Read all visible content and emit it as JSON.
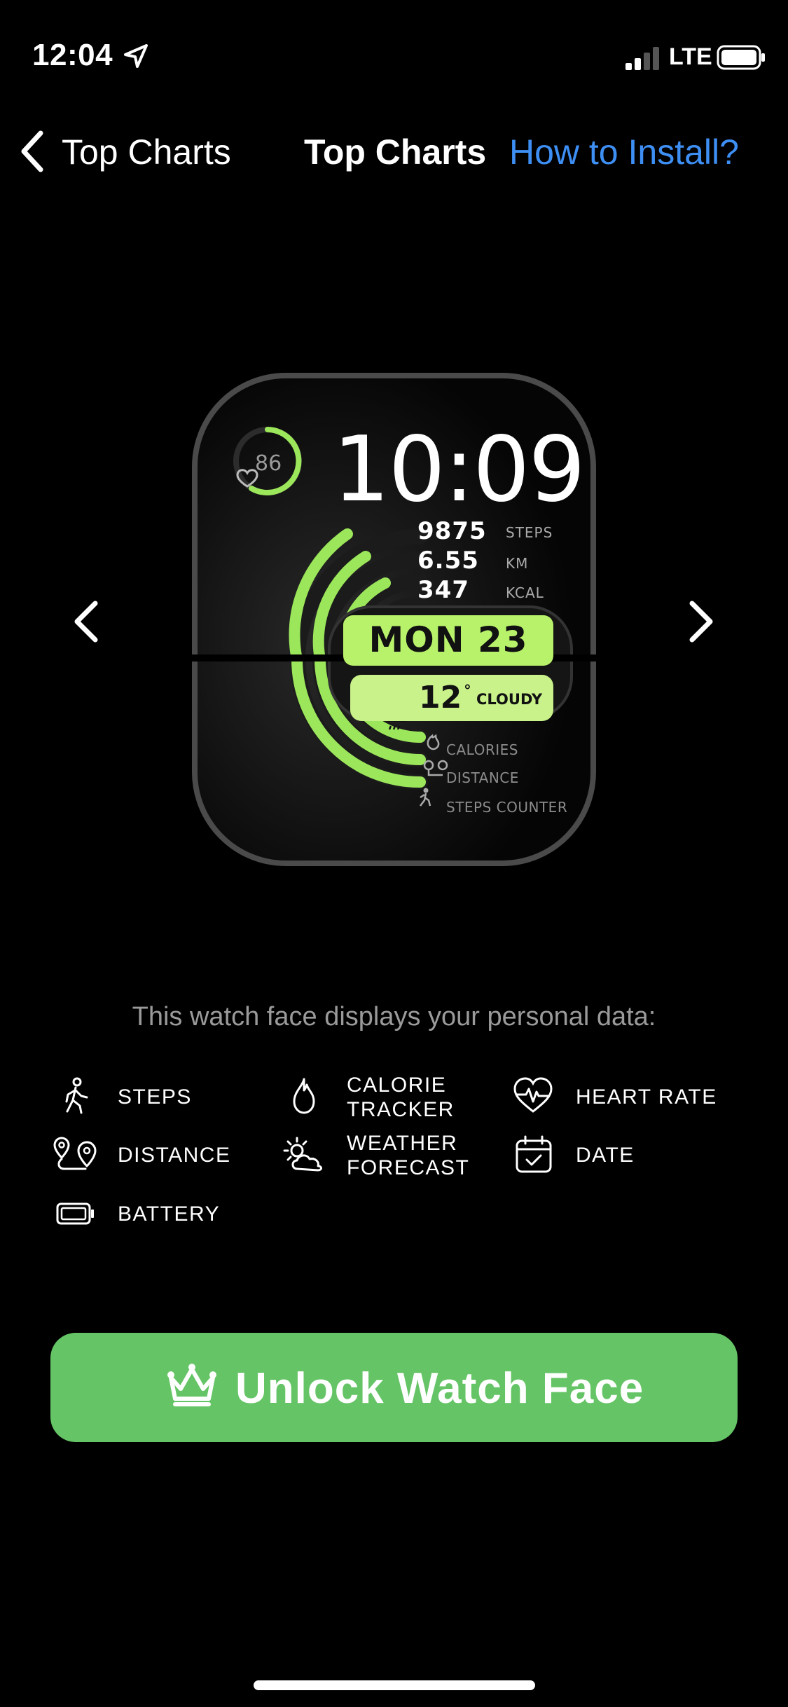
{
  "status_bar": {
    "time": "12:04",
    "network": "LTE"
  },
  "nav": {
    "back_label": "Top Charts",
    "title": "Top Charts",
    "help_link": "How to Install?"
  },
  "watch_face": {
    "time": "10:09",
    "heart_rate": "86",
    "stats": [
      {
        "value": "9875",
        "unit": "STEPS"
      },
      {
        "value": "6.55",
        "unit": "KM"
      },
      {
        "value": "347",
        "unit": "KCAL"
      }
    ],
    "date": "MON 23",
    "weather": {
      "temp": "12",
      "degree": "°",
      "condition": "CLOUDY"
    },
    "legend": [
      "CALORIES",
      "DISTANCE",
      "STEPS COUNTER"
    ],
    "accent_color": "#9be65a"
  },
  "info": {
    "title": "This watch face displays your personal data:",
    "features": [
      {
        "icon": "walking-person-icon",
        "line1": "STEPS",
        "line2": ""
      },
      {
        "icon": "flame-icon",
        "line1": "CALORIE",
        "line2": "TRACKER"
      },
      {
        "icon": "heart-rate-icon",
        "line1": "HEART RATE",
        "line2": ""
      },
      {
        "icon": "distance-pins-icon",
        "line1": "DISTANCE",
        "line2": ""
      },
      {
        "icon": "sun-cloud-icon",
        "line1": "WEATHER",
        "line2": "FORECAST"
      },
      {
        "icon": "calendar-check-icon",
        "line1": "DATE",
        "line2": ""
      },
      {
        "icon": "battery-icon",
        "line1": "BATTERY",
        "line2": ""
      }
    ]
  },
  "cta": {
    "label": "Unlock Watch Face",
    "icon": "crown-icon",
    "color": "#65c466"
  }
}
